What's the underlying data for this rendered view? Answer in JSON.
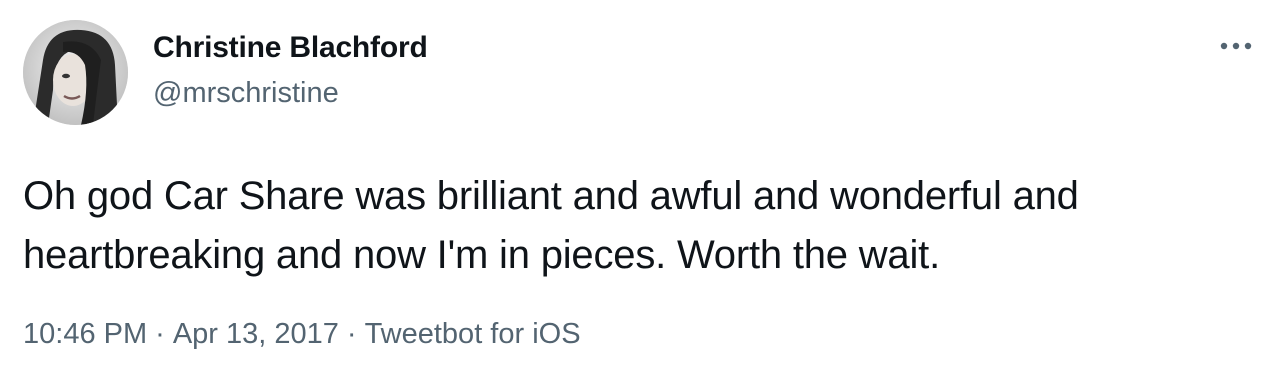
{
  "tweet": {
    "author": {
      "display_name": "Christine Blachford",
      "handle": "@mrschristine",
      "avatar_icon": "profile-photo"
    },
    "more_icon": "more-horizontal-icon",
    "text": "Oh god Car Share was brilliant and awful and wonderful and heartbreaking and now I'm in pieces. Worth the wait.",
    "time": "10:46 PM",
    "separator": "·",
    "date": "Apr 13, 2017",
    "source": "Tweetbot for iOS"
  },
  "colors": {
    "text_primary": "#0f1419",
    "text_secondary": "#536471",
    "background": "#ffffff"
  }
}
